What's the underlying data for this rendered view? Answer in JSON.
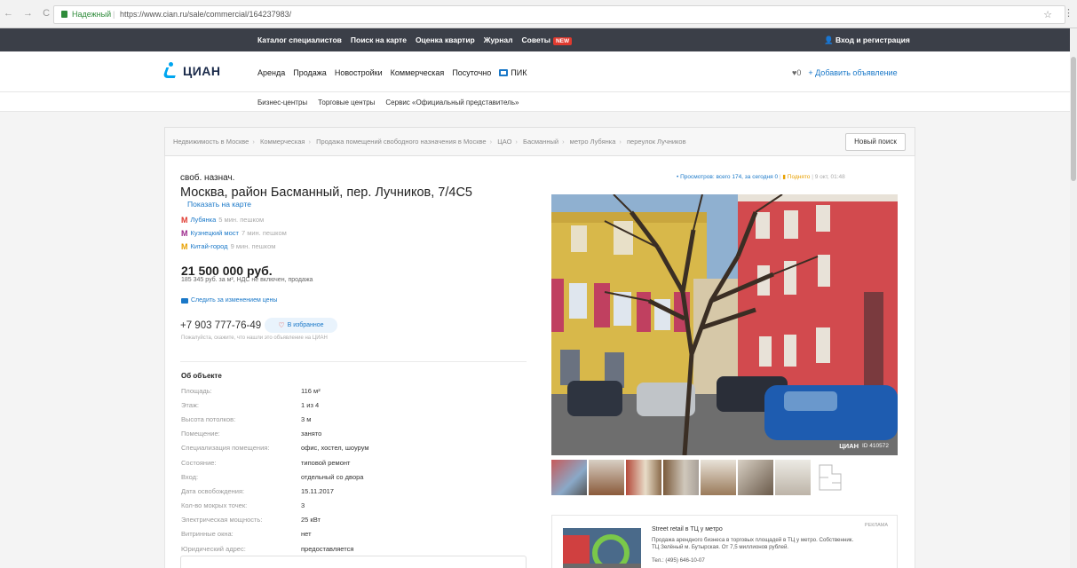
{
  "browser": {
    "secure_label": "Надежный",
    "url": "https://www.cian.ru/sale/commercial/164237983/",
    "nav_glyphs": "← → C"
  },
  "topbar": {
    "links": [
      "Каталог специалистов",
      "Поиск на карте",
      "Оценка квартир",
      "Журнал",
      "Советы"
    ],
    "new_badge": "NEW",
    "login": "Вход и регистрация"
  },
  "header": {
    "logo": "ЦИАН",
    "nav": [
      "Аренда",
      "Продажа",
      "Новостройки",
      "Коммерческая",
      "Посуточно"
    ],
    "pik": "ПИК",
    "favorites_count": "0",
    "add_ad": "+ Добавить объявление"
  },
  "subnav": {
    "items": [
      "Бизнес-центры",
      "Торговые центры",
      "Сервис «Официальный представитель»"
    ]
  },
  "breadcrumb": {
    "items": [
      "Недвижимость в Москве",
      "Коммерческая",
      "Продажа помещений свободного назначения в Москве",
      "ЦАО",
      "Басманный",
      "метро Лубянка",
      "переулок Лучников"
    ],
    "new_search": "Новый поиск"
  },
  "listing": {
    "type": "своб. назнач.",
    "address": "Москва, район Басманный, пер. Лучников, 7/4С5",
    "show_map": "Показать на карте",
    "metro": [
      {
        "name": "Лубянка",
        "distance": "5 мин. пешком",
        "color": "#e03a2f"
      },
      {
        "name": "Кузнецкий мост",
        "distance": "7 мин. пешком",
        "color": "#9c2a8c"
      },
      {
        "name": "Китай-город",
        "distance": "9 мин. пешком",
        "color": "#e8a000"
      }
    ],
    "price": "21 500 000 руб.",
    "price_sub": "185 345 руб. за м², НДС не включен, продажа",
    "watch_price": "Следить за изменением цены",
    "phone": "+7 903 777-76-49",
    "favorite": "В избранное",
    "please_note": "Пожалуйста, скажите, что нашли это объявление на ЦИАН",
    "object_title": "Об объекте",
    "params": [
      {
        "k": "Площадь:",
        "v": "116 м²"
      },
      {
        "k": "Этаж:",
        "v": "1 из 4"
      },
      {
        "k": "Высота потолков:",
        "v": "3 м"
      },
      {
        "k": "Помещение:",
        "v": "занято"
      },
      {
        "k": "Специализация помещения:",
        "v": "офис, хостел, шоурум"
      },
      {
        "k": "Состояние:",
        "v": "типовой ремонт"
      },
      {
        "k": "Вход:",
        "v": "отдельный со двора"
      },
      {
        "k": "Дата освобождения:",
        "v": "15.11.2017"
      },
      {
        "k": "Кол-во мокрых точек:",
        "v": "3"
      },
      {
        "k": "Электрическая мощность:",
        "v": "25 кВт"
      },
      {
        "k": "Витринные окна:",
        "v": "нет"
      },
      {
        "k": "Юридический адрес:",
        "v": "предоставляется"
      }
    ]
  },
  "right": {
    "views": "• Просмотров: всего 174, за сегодня 0",
    "pin": "Поднято",
    "time": "9 окт, 01:48",
    "watermark_logo": "ЦИАН",
    "watermark_id": "ID 410572"
  },
  "ad": {
    "title": "Street retail в ТЦ у метро",
    "label": "РЕКЛАМА",
    "text": "Продажа арендного бизнеса в торговых площадей в ТЦ у метро. Собственник. ТЦ Зелёный м. Бутырская. От 7,5 миллионов рублей.",
    "tel": "Тел.: (495) 646-10-07"
  },
  "colors": {
    "brand": "#00a6f0",
    "topbar": "#3b3f48",
    "link": "#1a78c8"
  }
}
